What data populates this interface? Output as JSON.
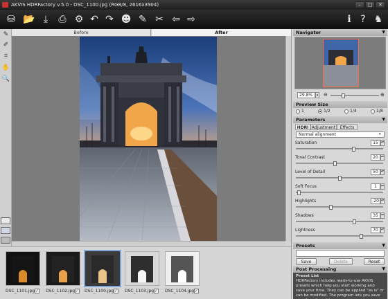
{
  "window": {
    "title": "AKVIS HDRFactory v.5.0 - DSC_1100.jpg (RGB/8, 2616x3904)"
  },
  "toolbar": {
    "icons": [
      "open-icon",
      "save-icon",
      "print-icon",
      "batch-icon",
      "undo-icon",
      "redo-icon",
      "run-icon",
      "settings-brush-icon",
      "preferences-icon",
      "back-icon",
      "forward-icon",
      "info-icon",
      "help-icon",
      "about-icon"
    ]
  },
  "view": {
    "before_label": "Before",
    "after_label": "After"
  },
  "filmstrip": {
    "items": [
      {
        "name": "DSC_1101.jpg",
        "checked": "✓"
      },
      {
        "name": "DSC_1102.jpg",
        "checked": "✓"
      },
      {
        "name": "DSC_1100.jpg",
        "checked": "✓"
      },
      {
        "name": "DSC_1103.jpg",
        "checked": "✓"
      },
      {
        "name": "DSC_1104.jpg",
        "checked": "✓"
      }
    ]
  },
  "navigator": {
    "title": "Navigator",
    "zoom": "29.8%"
  },
  "preview_size": {
    "title": "Preview Size",
    "options": [
      "1",
      "1/2",
      "1/4",
      "1/8"
    ],
    "selected": "1/2"
  },
  "parameters": {
    "title": "Parameters",
    "tabs": [
      "HDRI",
      "Adjustment",
      "Effects"
    ],
    "active_tab": "HDRI",
    "alignment": "Normal alignment",
    "rows": [
      {
        "label": "Saturation",
        "value": "15",
        "level": 0.67
      },
      {
        "label": "Tonal Contrast",
        "value": "20",
        "level": 0.45
      },
      {
        "label": "Level of Detail",
        "value": "50",
        "level": 0.5
      },
      {
        "label": "Soft Focus",
        "value": "1",
        "level": 0.02
      },
      {
        "label": "Highlights",
        "value": "-20",
        "level": 0.4
      },
      {
        "label": "Shadows",
        "value": "35",
        "level": 0.68
      },
      {
        "label": "Lightness",
        "value": "70",
        "level": 0.76
      }
    ]
  },
  "presets": {
    "title": "Presets",
    "save": "Save",
    "delete": "Delete",
    "reset": "Reset"
  },
  "post_processing": {
    "title": "Post Processing",
    "preset_list": "Preset List",
    "desc": "HDRFactory includes ready-to-use AKVIS presets which help you start working and save your time. They can be applied \"as is\" or can be modified. The program lets you save your favorite settings"
  },
  "colors": {
    "toolbar_bg": "#1a1a1a",
    "canvas_bg": "#7c7c7c",
    "selection": "#7fa8d8"
  }
}
